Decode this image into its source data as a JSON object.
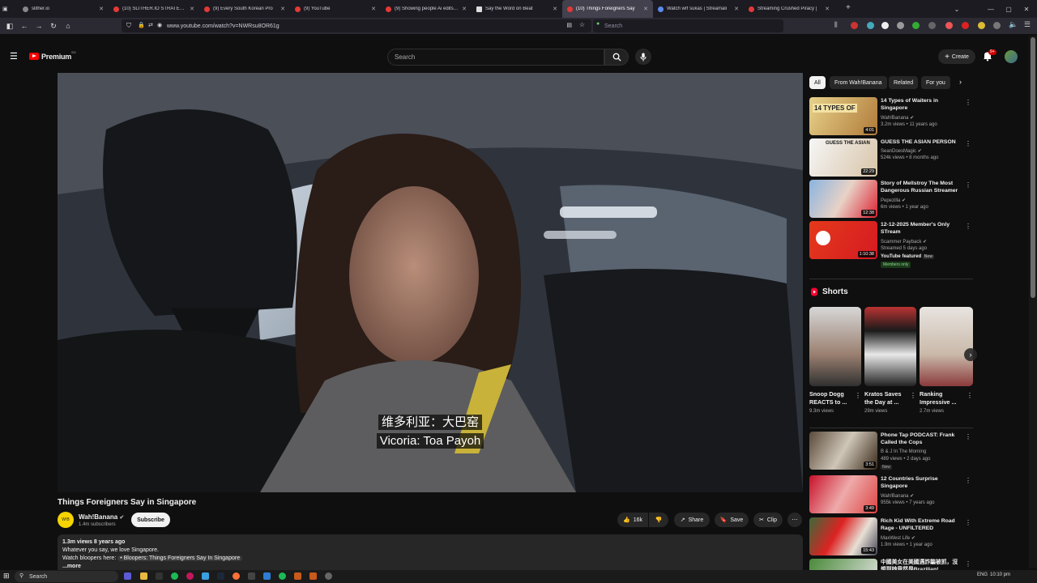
{
  "browser": {
    "tabs": [
      {
        "title": "slither.io",
        "icon": "gray"
      },
      {
        "title": "(10) SLITHER.IO STRATEGIES, TI",
        "icon": "red"
      },
      {
        "title": "(9) Every South Korean Pro",
        "icon": "red"
      },
      {
        "title": "(9) YouTube",
        "icon": "red"
      },
      {
        "title": "(9) Showing people Ai edits of",
        "icon": "red"
      },
      {
        "title": "Say the Word on Beat",
        "icon": "white"
      },
      {
        "title": "(10) Things Foreigners Say",
        "icon": "red"
      },
      {
        "title": "Watch wrf sukas | Streamali",
        "icon": "blue"
      },
      {
        "title": "Streaming Crushed Piracy |",
        "icon": "red"
      }
    ],
    "url": "www.youtube.com/watch?v=NWRsu8OR61g",
    "search_placeholder": "Search"
  },
  "youtube": {
    "logo_text": "Premium",
    "logo_sup": "SG",
    "search_placeholder": "Search",
    "create_label": "Create",
    "notif_count": "9+"
  },
  "video": {
    "caption_zh": "维多利亚：大巴窑",
    "caption_en": "Vicoria: Toa Payoh",
    "title": "Things Foreigners Say in Singapore",
    "channel": "Wah!Banana",
    "subs": "1.4m subscribers",
    "subscribe_label": "Subscribe",
    "likes": "16k",
    "share_label": "Share",
    "save_label": "Save",
    "clip_label": "Clip",
    "desc_stats": "1.3m views  8 years ago",
    "desc_line1": "Whatever you say, we love Singapore.",
    "desc_line2": "Watch bloopers here:",
    "desc_link": "• Bloopers: Things Foreigners Say In Singapore",
    "desc_more": "...more"
  },
  "chips": [
    "All",
    "From Wah!Banana",
    "Related",
    "For you"
  ],
  "recommendations_top": [
    {
      "title": "14 Types of Waiters in Singapore",
      "channel": "Wah!Banana",
      "meta": "3.2m views • 11 years ago",
      "duration": "4:01"
    },
    {
      "title": "GUESS THE ASIAN PERSON",
      "channel": "SeanDoesMagic",
      "meta": "524k views • 8 months ago",
      "duration": "22:29"
    },
    {
      "title": "Story of Mellstroy The Most Dangerous Russian Streamer",
      "channel": "Pepezilla",
      "meta": "6m views • 1 year ago",
      "duration": "12:38"
    },
    {
      "title": "12-12-2025 Member's Only STream",
      "channel": "Scammer Payback",
      "meta": "Streamed 5 days ago",
      "duration": "1:10:38",
      "extra": "YouTube featured",
      "badge_new": "New",
      "members": "Members only"
    }
  ],
  "shorts": {
    "header": "Shorts",
    "items": [
      {
        "title": "Snoop Dogg REACTS to ...",
        "views": "9.3m views"
      },
      {
        "title": "Kratos Saves the Day at ...",
        "views": "29m views"
      },
      {
        "title": "Ranking Impressive ...",
        "views": "2.7m views"
      }
    ]
  },
  "recommendations_bottom": [
    {
      "title": "Phone Tap PODCAST: Frank Called the Cops",
      "channel": "B & J In The Morning",
      "meta": "489 views • 2 days ago",
      "duration": "3:51",
      "badge_new": "New"
    },
    {
      "title": "12 Countries Surprise Singapore",
      "channel": "Wah!Banana",
      "meta": "955k views • 7 years ago",
      "duration": "3:49"
    },
    {
      "title": "Rich Kid With Extreme Road Rage - UNFILTERED",
      "channel": "MaxWest Life",
      "meta": "1.9m views • 1 year ago",
      "duration": "15:43"
    },
    {
      "title": "中國美女在美國遇詐騙被抓，沒想到她竟然是Brazilian!",
      "channel": "",
      "meta": "",
      "duration": ""
    }
  ],
  "taskbar": {
    "search_label": "Search",
    "lang": "ENG",
    "time": "10:10 pm"
  }
}
